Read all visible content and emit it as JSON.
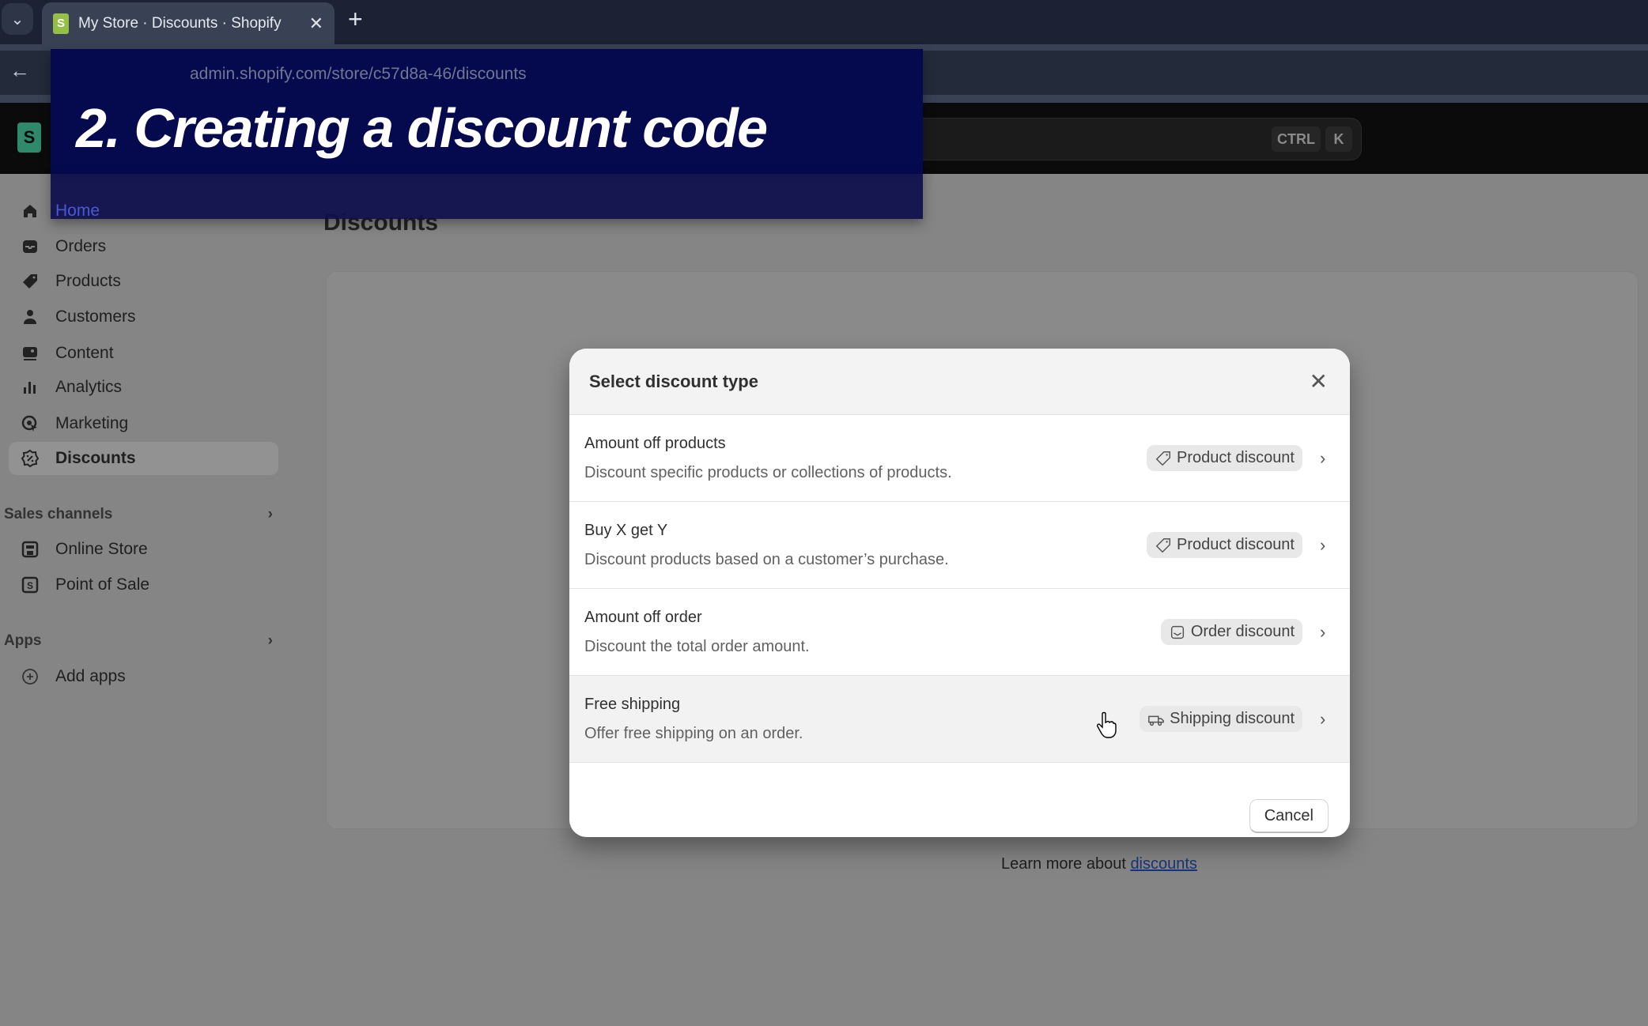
{
  "browser": {
    "tab_title": "My Store · Discounts · Shopify",
    "url": "admin.shopify.com/store/c57d8a-46/discounts",
    "tab_close": "✕",
    "new_tab": "+"
  },
  "header": {
    "logo_letter": "S",
    "search_shortcut": [
      "CTRL",
      "K"
    ]
  },
  "banner": {
    "text": "2. Creating a discount code"
  },
  "sidebar": {
    "items": [
      {
        "label": "Home",
        "icon": "home-icon"
      },
      {
        "label": "Orders",
        "icon": "inbox-icon"
      },
      {
        "label": "Products",
        "icon": "tag-icon"
      },
      {
        "label": "Customers",
        "icon": "person-icon"
      },
      {
        "label": "Content",
        "icon": "image-icon"
      },
      {
        "label": "Analytics",
        "icon": "bar-chart-icon"
      },
      {
        "label": "Marketing",
        "icon": "target-icon"
      },
      {
        "label": "Discounts",
        "icon": "discount-icon",
        "selected": true
      }
    ],
    "sales_channels": {
      "label": "Sales channels",
      "items": [
        {
          "label": "Online Store"
        },
        {
          "label": "Point of Sale"
        }
      ]
    },
    "apps": {
      "label": "Apps",
      "items": [
        {
          "label": "Add apps"
        }
      ]
    }
  },
  "main": {
    "title": "Discounts",
    "learn_more_prefix": "Learn more about ",
    "learn_more_link": "discounts"
  },
  "modal": {
    "title": "Select discount type",
    "options": [
      {
        "title": "Amount off products",
        "description": "Discount specific products or collections of products.",
        "badge": "Product discount",
        "badge_icon": "tag-icon"
      },
      {
        "title": "Buy X get Y",
        "description": "Discount products based on a customer’s purchase.",
        "badge": "Product discount",
        "badge_icon": "tag-icon"
      },
      {
        "title": "Amount off order",
        "description": "Discount the total order amount.",
        "badge": "Order discount",
        "badge_icon": "cart-icon"
      },
      {
        "title": "Free shipping",
        "description": "Offer free shipping on an order.",
        "badge": "Shipping discount",
        "badge_icon": "truck-icon",
        "hovered": true
      }
    ],
    "cancel_label": "Cancel"
  }
}
